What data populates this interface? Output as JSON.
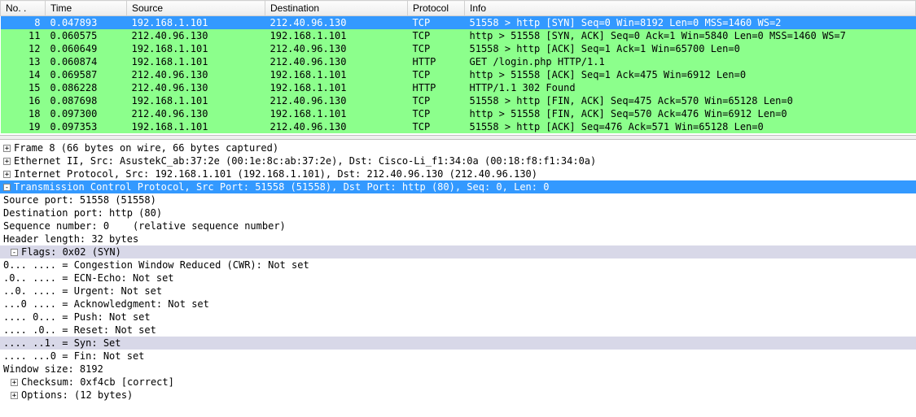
{
  "columns": {
    "no": "No. .",
    "time": "Time",
    "source": "Source",
    "destination": "Destination",
    "protocol": "Protocol",
    "info": "Info"
  },
  "packets": [
    {
      "no": "8",
      "time": "0.047893",
      "src": "192.168.1.101",
      "dst": "212.40.96.130",
      "proto": "TCP",
      "info": "51558 > http [SYN] Seq=0 Win=8192 Len=0 MSS=1460 WS=2",
      "style": "selected"
    },
    {
      "no": "11",
      "time": "0.060575",
      "src": "212.40.96.130",
      "dst": "192.168.1.101",
      "proto": "TCP",
      "info": "http > 51558 [SYN, ACK] Seq=0 Ack=1 Win=5840 Len=0 MSS=1460 WS=7",
      "style": "green"
    },
    {
      "no": "12",
      "time": "0.060649",
      "src": "192.168.1.101",
      "dst": "212.40.96.130",
      "proto": "TCP",
      "info": "51558 > http [ACK] Seq=1 Ack=1 Win=65700 Len=0",
      "style": "green"
    },
    {
      "no": "13",
      "time": "0.060874",
      "src": "192.168.1.101",
      "dst": "212.40.96.130",
      "proto": "HTTP",
      "info": "GET /login.php HTTP/1.1",
      "style": "green"
    },
    {
      "no": "14",
      "time": "0.069587",
      "src": "212.40.96.130",
      "dst": "192.168.1.101",
      "proto": "TCP",
      "info": "http > 51558 [ACK] Seq=1 Ack=475 Win=6912 Len=0",
      "style": "green"
    },
    {
      "no": "15",
      "time": "0.086228",
      "src": "212.40.96.130",
      "dst": "192.168.1.101",
      "proto": "HTTP",
      "info": "HTTP/1.1 302 Found",
      "style": "green"
    },
    {
      "no": "16",
      "time": "0.087698",
      "src": "192.168.1.101",
      "dst": "212.40.96.130",
      "proto": "TCP",
      "info": "51558 > http [FIN, ACK] Seq=475 Ack=570 Win=65128 Len=0",
      "style": "green"
    },
    {
      "no": "18",
      "time": "0.097300",
      "src": "212.40.96.130",
      "dst": "192.168.1.101",
      "proto": "TCP",
      "info": "http > 51558 [FIN, ACK] Seq=570 Ack=476 Win=6912 Len=0",
      "style": "green"
    },
    {
      "no": "19",
      "time": "0.097353",
      "src": "192.168.1.101",
      "dst": "212.40.96.130",
      "proto": "TCP",
      "info": "51558 > http [ACK] Seq=476 Ack=571 Win=65128 Len=0",
      "style": "green"
    }
  ],
  "details": {
    "frame": "Frame 8 (66 bytes on wire, 66 bytes captured)",
    "eth": "Ethernet II, Src: AsustekC_ab:37:2e (00:1e:8c:ab:37:2e), Dst: Cisco-Li_f1:34:0a (00:18:f8:f1:34:0a)",
    "ip": "Internet Protocol, Src: 192.168.1.101 (192.168.1.101), Dst: 212.40.96.130 (212.40.96.130)",
    "tcp": "Transmission Control Protocol, Src Port: 51558 (51558), Dst Port: http (80), Seq: 0, Len: 0",
    "srcport": "Source port: 51558 (51558)",
    "dstport": "Destination port: http (80)",
    "seq": "Sequence number: 0    (relative sequence number)",
    "hlen": "Header length: 32 bytes",
    "flags": "Flags: 0x02 (SYN)",
    "f_cwr": "0... .... = Congestion Window Reduced (CWR): Not set",
    "f_ecn": ".0.. .... = ECN-Echo: Not set",
    "f_urg": "..0. .... = Urgent: Not set",
    "f_ack": "...0 .... = Acknowledgment: Not set",
    "f_psh": ".... 0... = Push: Not set",
    "f_rst": ".... .0.. = Reset: Not set",
    "f_syn": ".... ..1. = Syn: Set",
    "f_fin": ".... ...0 = Fin: Not set",
    "winsize": "Window size: 8192",
    "cksum": "Checksum: 0xf4cb [correct]",
    "options": "Options: (12 bytes)"
  },
  "glyph": {
    "plus": "+",
    "minus": "-"
  }
}
